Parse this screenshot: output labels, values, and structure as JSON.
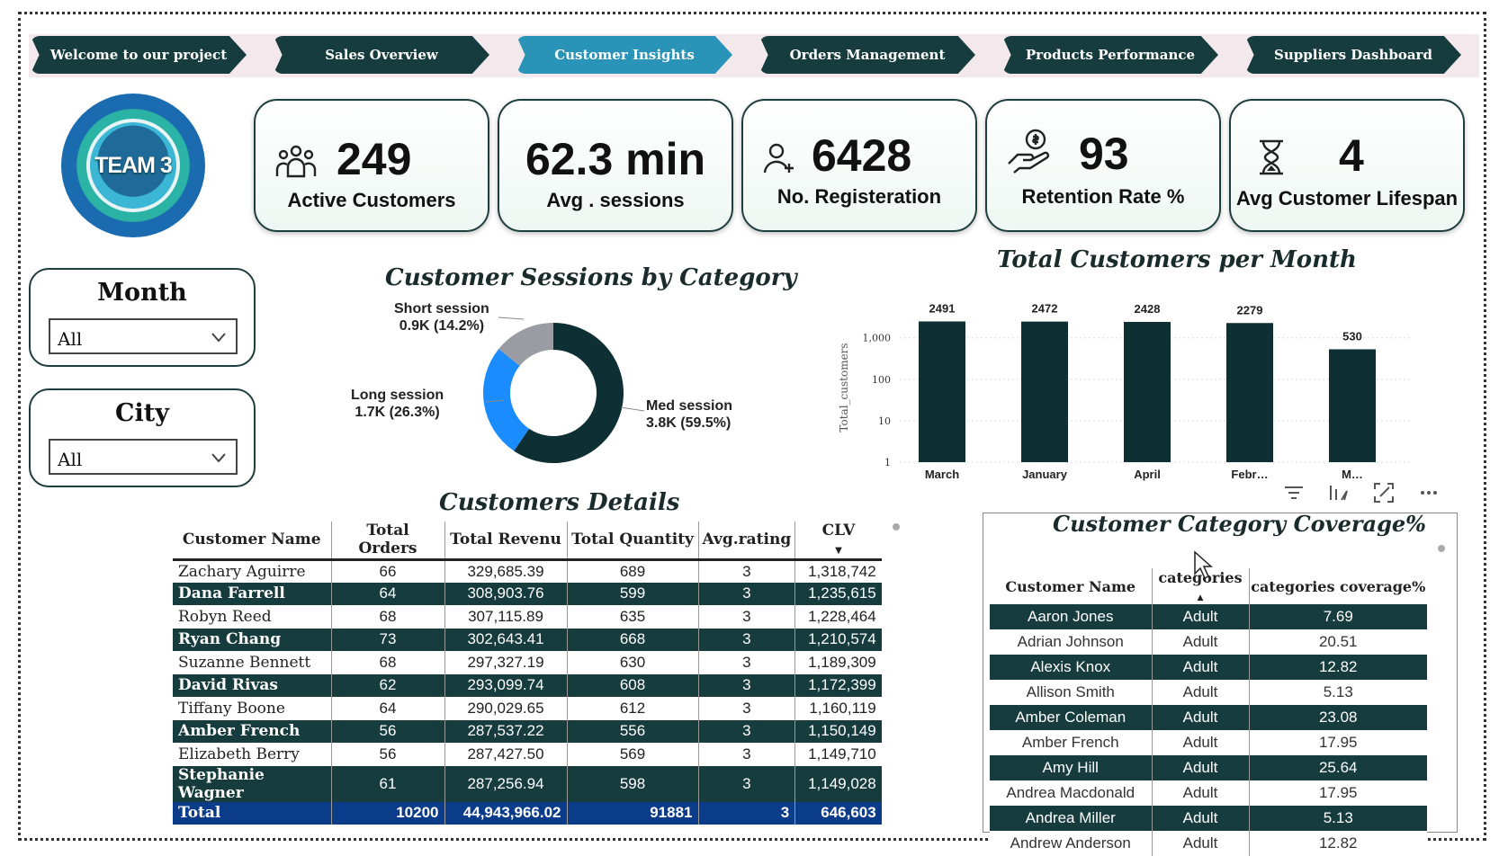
{
  "nav": {
    "tabs": [
      {
        "label": "Welcome to our project"
      },
      {
        "label": "Sales Overview"
      },
      {
        "label": "Customer Insights"
      },
      {
        "label": "Orders Management"
      },
      {
        "label": "Products Performance"
      },
      {
        "label": "Suppliers Dashboard"
      }
    ],
    "active_index": 2
  },
  "logo": {
    "text": "TEAM 3"
  },
  "kpis": [
    {
      "value": "249",
      "label": "Active Customers",
      "icon": "people-group-icon"
    },
    {
      "value": "62.3 min",
      "label": "Avg . sessions"
    },
    {
      "value": "6428",
      "label": "No. Registeration",
      "icon": "user-add-icon"
    },
    {
      "value": "93",
      "label": "Retention Rate %",
      "icon": "hand-coin-icon"
    },
    {
      "value": "4",
      "label": "Avg Customer Lifespan",
      "icon": "hourglass-icon"
    }
  ],
  "slicers": {
    "month": {
      "title": "Month",
      "value": "All"
    },
    "city": {
      "title": "City",
      "value": "All"
    }
  },
  "donut": {
    "title": "Customer Sessions by Category",
    "colors": {
      "short": "#9b9ca3",
      "long": "#1a8cff",
      "med": "#0e2f33"
    },
    "segments": [
      {
        "name": "Short session",
        "value_label": "0.9K (14.2%)",
        "percent": 14.2
      },
      {
        "name": "Long session",
        "value_label": "1.7K (26.3%)",
        "percent": 26.3
      },
      {
        "name": "Med session",
        "value_label": "3.8K (59.5%)",
        "percent": 59.5
      }
    ]
  },
  "chart_data": {
    "type": "bar",
    "title": "Total Customers per Month",
    "ylabel": "Total_customers",
    "yscale": "log",
    "yticks": [
      "1",
      "10",
      "100",
      "1,000"
    ],
    "categories": [
      "March",
      "January",
      "April",
      "Febr…",
      "M…"
    ],
    "values": [
      2491,
      2472,
      2428,
      2279,
      530
    ],
    "bar_color": "#0e2f33"
  },
  "details": {
    "title": "Customers Details",
    "columns": [
      "Customer Name",
      "Total Orders",
      "Total Revenu",
      "Total Quantity",
      "Avg.rating",
      "CLV"
    ],
    "rows": [
      [
        "Zachary Aguirre",
        "66",
        "329,685.39",
        "689",
        "3",
        "1,318,742"
      ],
      [
        "Dana Farrell",
        "64",
        "308,903.76",
        "599",
        "3",
        "1,235,615"
      ],
      [
        "Robyn Reed",
        "68",
        "307,115.89",
        "635",
        "3",
        "1,228,464"
      ],
      [
        "Ryan Chang",
        "73",
        "302,643.41",
        "668",
        "3",
        "1,210,574"
      ],
      [
        "Suzanne Bennett",
        "68",
        "297,327.19",
        "630",
        "3",
        "1,189,309"
      ],
      [
        "David Rivas",
        "62",
        "293,099.74",
        "608",
        "3",
        "1,172,399"
      ],
      [
        "Tiffany Boone",
        "64",
        "290,029.65",
        "612",
        "3",
        "1,160,119"
      ],
      [
        "Amber French",
        "56",
        "287,537.22",
        "556",
        "3",
        "1,150,149"
      ],
      [
        "Elizabeth Berry",
        "56",
        "287,427.50",
        "569",
        "3",
        "1,149,710"
      ],
      [
        "Stephanie Wagner",
        "61",
        "287,256.94",
        "598",
        "3",
        "1,149,028"
      ]
    ],
    "total": [
      "Total",
      "10200",
      "44,943,966.02",
      "91881",
      "3",
      "646,603"
    ]
  },
  "coverage": {
    "title": "Customer Category Coverage%",
    "columns": [
      "Customer Name",
      "categories",
      "categories coverage%"
    ],
    "rows": [
      [
        "Aaron Jones",
        "Adult",
        "7.69"
      ],
      [
        "Adrian Johnson",
        "Adult",
        "20.51"
      ],
      [
        "Alexis Knox",
        "Adult",
        "12.82"
      ],
      [
        "Allison Smith",
        "Adult",
        "5.13"
      ],
      [
        "Amber Coleman",
        "Adult",
        "23.08"
      ],
      [
        "Amber French",
        "Adult",
        "17.95"
      ],
      [
        "Amy Hill",
        "Adult",
        "25.64"
      ],
      [
        "Andrea Macdonald",
        "Adult",
        "17.95"
      ],
      [
        "Andrea Miller",
        "Adult",
        "5.13"
      ],
      [
        "Andrew Anderson",
        "Adult",
        "12.82"
      ]
    ]
  }
}
